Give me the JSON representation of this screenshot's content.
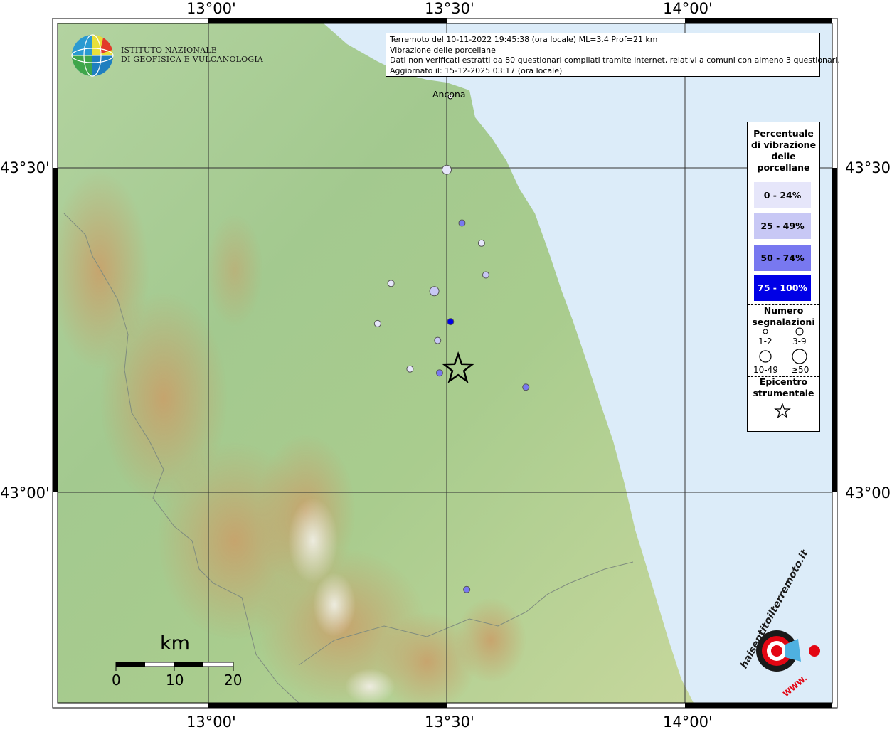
{
  "header": {
    "line1": "Terremoto del 10-11-2022 19:45:38 (ora locale) ML=3.4 Prof=21 km",
    "line2": "Vibrazione delle porcellane",
    "line3": "Dati non verificati estratti da 80 questionari compilati tramite Internet, relativi a comuni con almeno 3 questionari.",
    "line4": "Aggiornato il: 15-12-2025 03:17 (ora locale)"
  },
  "axes": {
    "top": [
      "13°00'",
      "13°30'",
      "14°00'"
    ],
    "bottom": [
      "13°00'",
      "13°30'",
      "14°00'"
    ],
    "left": [
      "43°30'",
      "43°00'"
    ],
    "right": [
      "43°30'",
      "43°00'"
    ]
  },
  "place_label": "Ancona",
  "logo": {
    "ingv_line1": "ISTITUTO NAZIONALE",
    "ingv_line2": "DI GEOFISICA E VULCANOLOGIA",
    "hsit_text": "haisentitoilterremoto.it",
    "hsit_url": "WWW."
  },
  "legend": {
    "title_lines": [
      "Percentuale",
      "di vibrazione",
      "delle",
      "porcellane"
    ],
    "classes": [
      {
        "label": "0 - 24%",
        "color": "#e6e6fa",
        "text_color": "#000000"
      },
      {
        "label": "25 - 49%",
        "color": "#c8c8f5",
        "text_color": "#000000"
      },
      {
        "label": "50 - 74%",
        "color": "#7878f0",
        "text_color": "#000000"
      },
      {
        "label": "75 - 100%",
        "color": "#0000e6",
        "text_color": "#ffffff"
      }
    ],
    "count_title_lines": [
      "Numero",
      "segnalazioni"
    ],
    "count_classes": [
      "1-2",
      "3-9",
      "10-49",
      "≥50"
    ],
    "epicenter_title_lines": [
      "Epicentro",
      "strumentale"
    ]
  },
  "scale_bar": {
    "unit": "km",
    "ticks": [
      "0",
      "10",
      "20"
    ]
  },
  "map_points": [
    {
      "lon": 13.5,
      "lat": 43.497,
      "size_class": "3-9",
      "pct_class": "0 - 24%"
    },
    {
      "lon": 13.532,
      "lat": 43.415,
      "size_class": "1-2",
      "pct_class": "50 - 74%"
    },
    {
      "lon": 13.573,
      "lat": 43.384,
      "size_class": "1-2",
      "pct_class": "0 - 24%"
    },
    {
      "lon": 13.383,
      "lat": 43.322,
      "size_class": "1-2",
      "pct_class": "0 - 24%"
    },
    {
      "lon": 13.582,
      "lat": 43.335,
      "size_class": "1-2",
      "pct_class": "25 - 49%"
    },
    {
      "lon": 13.474,
      "lat": 43.31,
      "size_class": "3-9",
      "pct_class": "25 - 49%"
    },
    {
      "lon": 13.508,
      "lat": 43.263,
      "size_class": "1-2",
      "pct_class": "75 - 100%"
    },
    {
      "lon": 13.355,
      "lat": 43.26,
      "size_class": "1-2",
      "pct_class": "0 - 24%"
    },
    {
      "lon": 13.481,
      "lat": 43.234,
      "size_class": "1-2",
      "pct_class": "25 - 49%"
    },
    {
      "lon": 13.423,
      "lat": 43.19,
      "size_class": "1-2",
      "pct_class": "0 - 24%"
    },
    {
      "lon": 13.485,
      "lat": 43.184,
      "size_class": "1-2",
      "pct_class": "50 - 74%"
    },
    {
      "lon": 13.666,
      "lat": 43.162,
      "size_class": "1-2",
      "pct_class": "50 - 74%"
    },
    {
      "lon": 13.542,
      "lat": 42.85,
      "size_class": "1-2",
      "pct_class": "50 - 74%"
    }
  ],
  "epicenter": {
    "lon": 13.524,
    "lat": 43.19
  },
  "colors": {
    "sea": "#dcecf9",
    "frame": "#000000",
    "accent_red": "#e30613"
  }
}
